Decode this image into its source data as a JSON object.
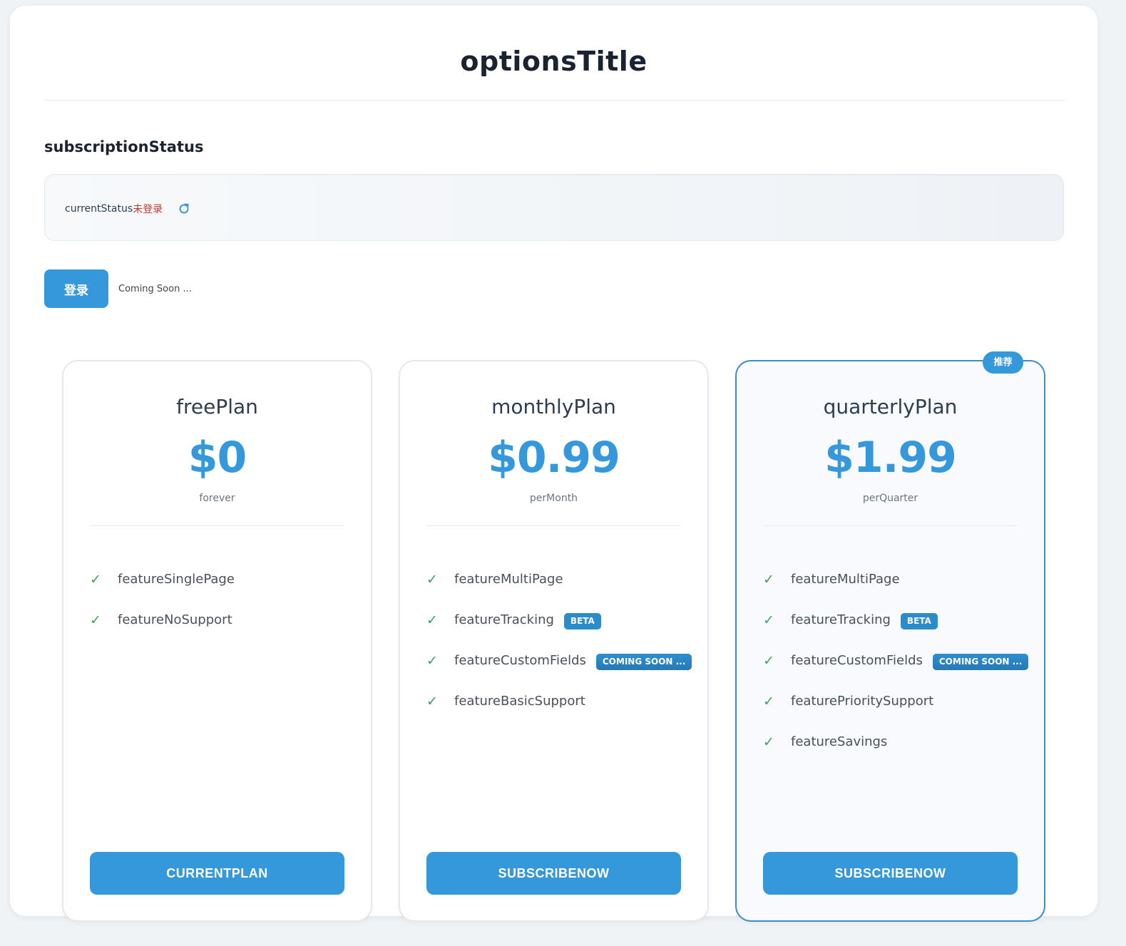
{
  "page": {
    "title": "optionsTitle",
    "section_heading": "subscriptionStatus"
  },
  "status": {
    "label": "currentStatus",
    "value": "未登录",
    "refresh_icon": "refresh-icon"
  },
  "login": {
    "button_label": "登录",
    "note": "Coming Soon ..."
  },
  "plans": [
    {
      "name": "freePlan",
      "price": "$0",
      "period": "forever",
      "features": [
        {
          "label": "featureSinglePage",
          "tag": ""
        },
        {
          "label": "featureNoSupport",
          "tag": ""
        }
      ],
      "button_label": "CURRENTPLAN"
    },
    {
      "name": "monthlyPlan",
      "price": "$0.99",
      "period": "perMonth",
      "features": [
        {
          "label": "featureMultiPage",
          "tag": ""
        },
        {
          "label": "featureTracking",
          "tag": "BETA"
        },
        {
          "label": "featureCustomFields",
          "tag": "COMING SOON ..."
        },
        {
          "label": "featureBasicSupport",
          "tag": ""
        }
      ],
      "button_label": "SUBSCRIBENOW"
    },
    {
      "name": "quarterlyPlan",
      "price": "$1.99",
      "period": "perQuarter",
      "badge": "推荐",
      "features": [
        {
          "label": "featureMultiPage",
          "tag": ""
        },
        {
          "label": "featureTracking",
          "tag": "BETA"
        },
        {
          "label": "featureCustomFields",
          "tag": "COMING SOON ..."
        },
        {
          "label": "featurePrioritySupport",
          "tag": ""
        },
        {
          "label": "featureSavings",
          "tag": ""
        }
      ],
      "button_label": "SUBSCRIBENOW"
    }
  ],
  "colors": {
    "accent": "#3498db",
    "status_value": "#c0392b",
    "check": "#3aa55a"
  },
  "icons": {
    "check": "check-icon"
  }
}
